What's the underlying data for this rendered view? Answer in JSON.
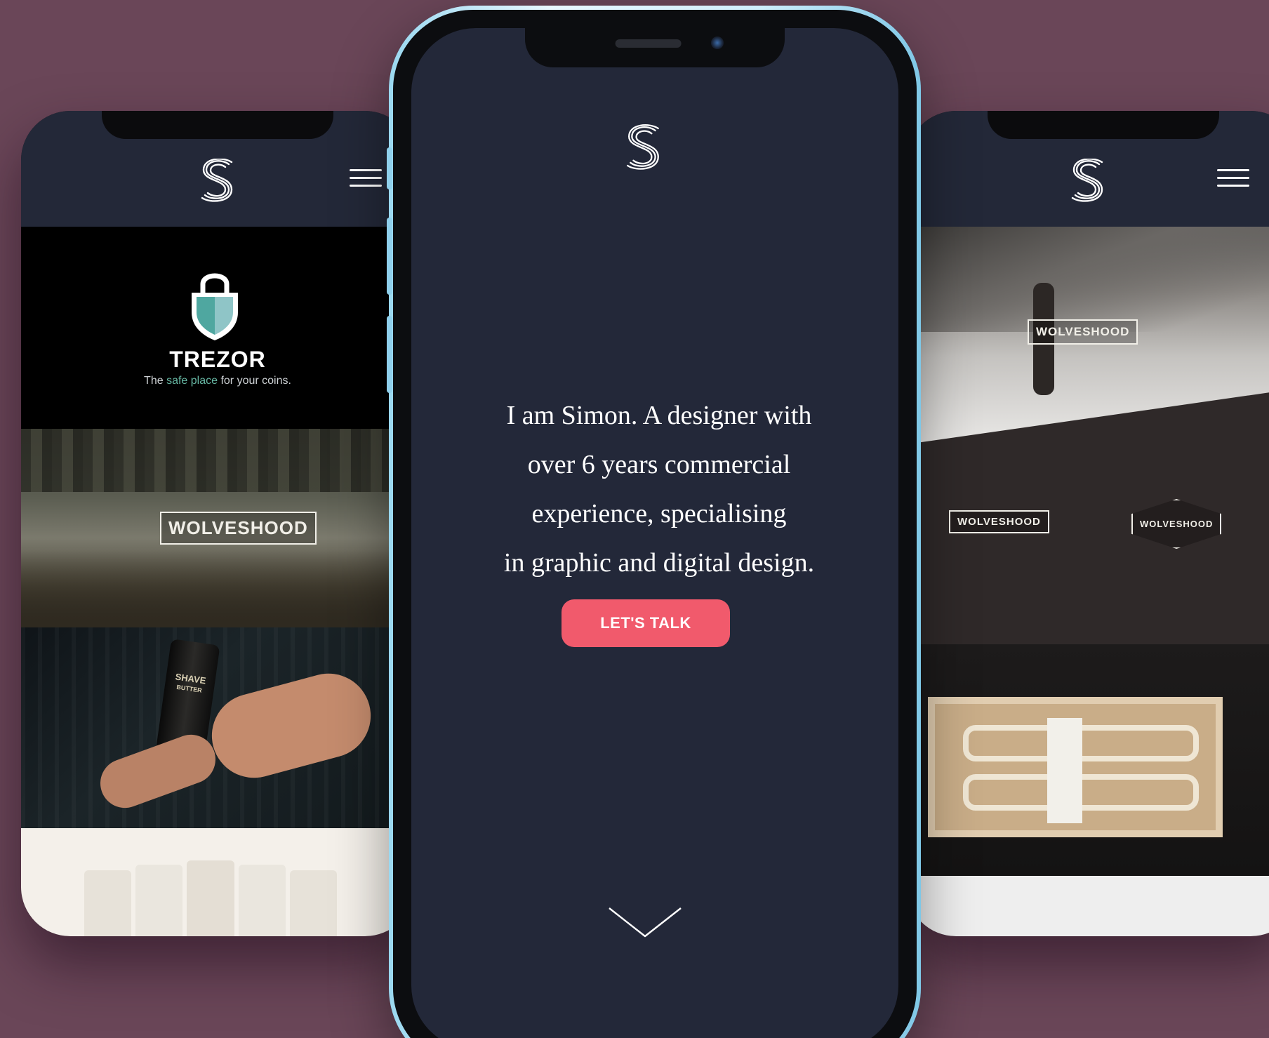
{
  "left_phone": {
    "logo": "S",
    "trezor": {
      "title": "TREZOR",
      "tagline_pre": "The ",
      "tagline_highlight": "safe place",
      "tagline_post": " for your coins."
    },
    "wolveshood_badge": "WOLVESHOOD",
    "shave_label_line1": "SHAVE",
    "shave_label_line2": "BUTTER"
  },
  "center_phone": {
    "logo": "S",
    "intro_lines": [
      "I am Simon. A designer with",
      "over 6 years commercial",
      "experience, specialising",
      "in graphic and digital design."
    ],
    "cta_label": "LET'S TALK"
  },
  "right_phone": {
    "logo": "S",
    "wolveshood_badge": "WOLVESHOOD",
    "badge_left": "WOLVESHOOD",
    "badge_right": "WOLVESHOOD"
  },
  "colors": {
    "background": "#6a4658",
    "screen_navy": "#232839",
    "cta": "#f15a6c",
    "trezor_accent": "#67b8a4"
  },
  "icons": [
    "s-logo-icon",
    "hamburger-menu-icon",
    "shield-lock-icon",
    "chevron-down-icon"
  ]
}
